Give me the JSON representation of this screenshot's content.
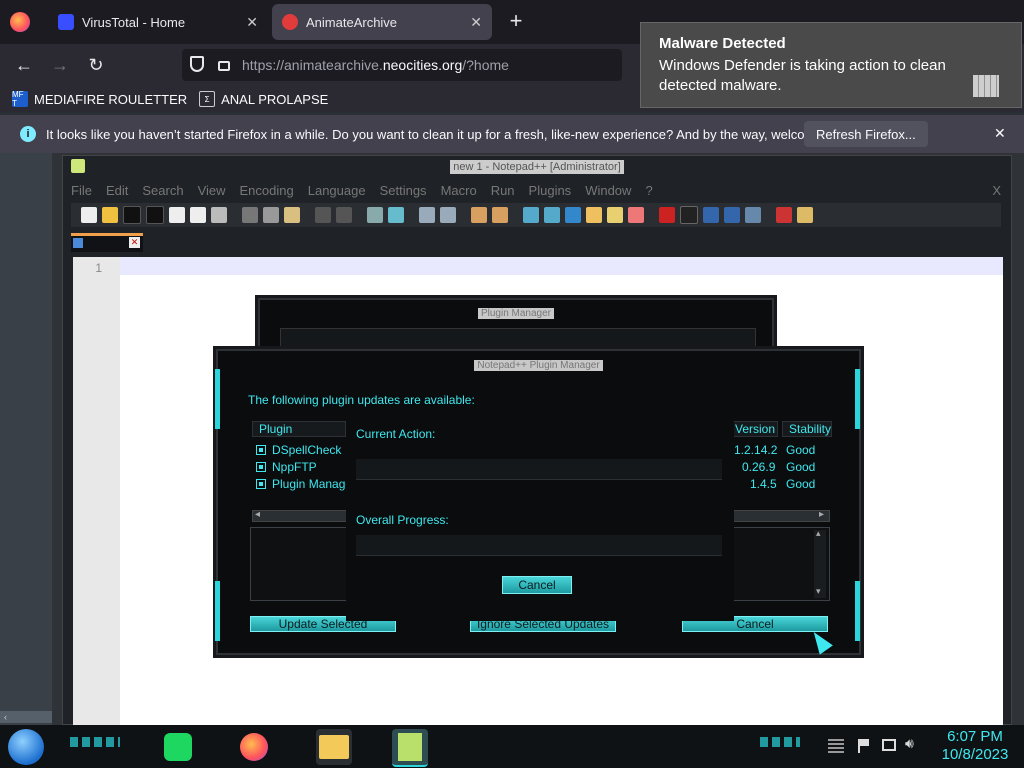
{
  "browser": {
    "tabs": [
      {
        "label": "VirusTotal - Home",
        "active": false
      },
      {
        "label": "AnimateArchive",
        "active": true
      }
    ],
    "new_tab": "+",
    "url_main": "https://animatearchive.",
    "url_domain": "neocities.org",
    "url_path": "/?home",
    "bookmarks": [
      {
        "label": "MEDIAFIRE ROULETTER",
        "icon_text": "MF T"
      },
      {
        "label": "ANAL PROLAPSE",
        "icon_text": "Σ"
      }
    ],
    "notice": {
      "text": "It looks like you haven’t started Firefox in a while. Do you want to clean it up for a fresh, like-new experience? And by the way, welcome back!",
      "button": "Refresh Firefox..."
    }
  },
  "toast": {
    "title": "Malware Detected",
    "body": "Windows Defender is taking action to clean detected malware."
  },
  "notepad": {
    "title": "new 1 - Notepad++ [Administrator]",
    "menu": [
      "File",
      "Edit",
      "Search",
      "View",
      "Encoding",
      "Language",
      "Settings",
      "Macro",
      "Run",
      "Plugins",
      "Window",
      "?"
    ],
    "line_number": "1",
    "close_x": "X"
  },
  "plugin_manager_back": {
    "title": "Plugin Manager"
  },
  "plugin_manager": {
    "title": "Notepad++ Plugin Manager",
    "intro": "The following plugin updates are available:",
    "columns": {
      "plugin": "Plugin",
      "version": "Version",
      "stability": "Stability"
    },
    "rows": [
      {
        "plugin": "DSpellCheck",
        "version": "1.2.14.2",
        "stability": "Good"
      },
      {
        "plugin": "NppFTP",
        "version": "0.26.9",
        "stability": "Good"
      },
      {
        "plugin": "Plugin Manager",
        "version": "1.4.5",
        "stability": "Good"
      }
    ],
    "update_btn": "Update Selected",
    "ignore_btn": "Ignore Selected Updates",
    "cancel_btn": "Cancel"
  },
  "progress": {
    "current_action": "Current Action:",
    "overall_progress": "Overall Progress:",
    "cancel": "Cancel"
  },
  "taskbar": {
    "time": "6:07 PM",
    "date": "10/8/2023"
  }
}
